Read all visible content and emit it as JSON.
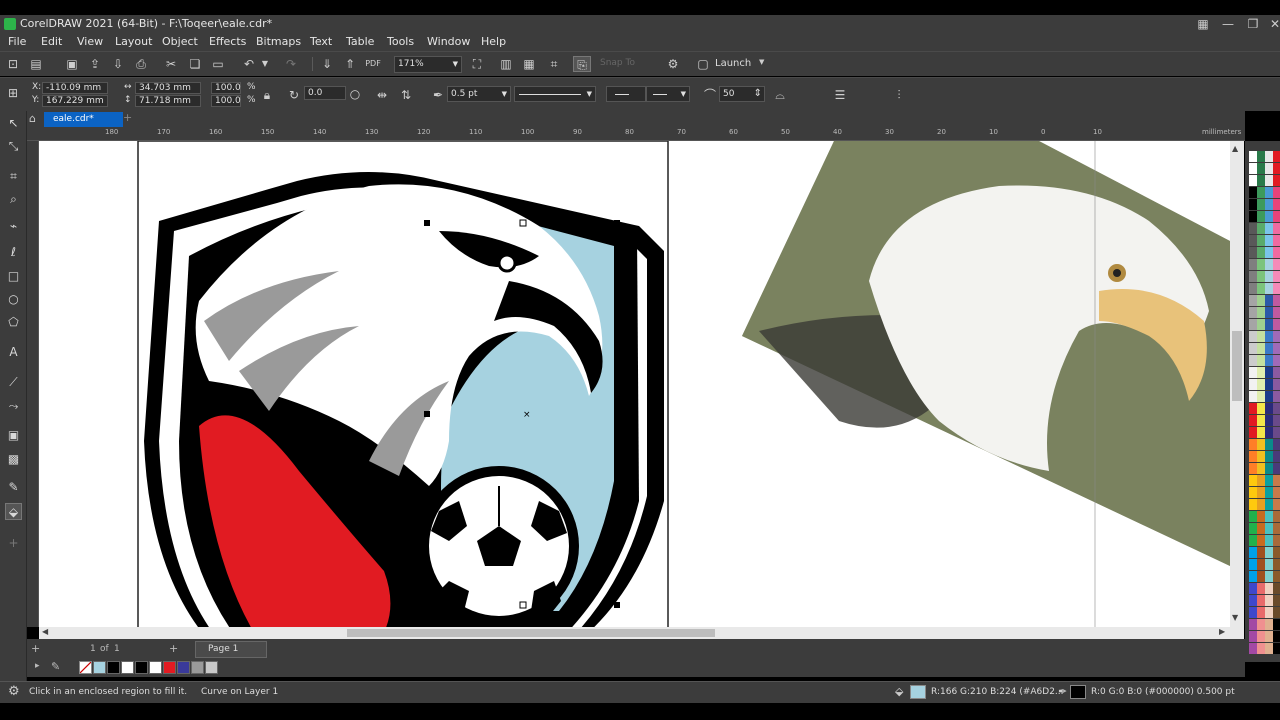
{
  "app": {
    "title": "CorelDRAW 2021 (64-Bit) - F:\\Toqeer\\eale.cdr*"
  },
  "menu": [
    "File",
    "Edit",
    "View",
    "Layout",
    "Object",
    "Effects",
    "Bitmaps",
    "Text",
    "Table",
    "Tools",
    "Window",
    "Help"
  ],
  "toolbar": {
    "zoom": "171%",
    "snap_to": "Snap To",
    "launch": "Launch"
  },
  "propbar": {
    "x_label": "X:",
    "y_label": "Y:",
    "x": "-110.09 mm",
    "y": "167.229 mm",
    "w": "34.703 mm",
    "h": "71.718 mm",
    "scale_w": "100.0",
    "scale_h": "100.0",
    "pct": "%",
    "rotation": "0.0",
    "outline_width": "0.5 pt",
    "smooth_value": "50"
  },
  "document_tab": "eale.cdr*",
  "ruler": {
    "units": "millimeters",
    "ticks": [
      "180",
      "170",
      "160",
      "150",
      "140",
      "130",
      "120",
      "110",
      "100",
      "90",
      "80",
      "70",
      "60",
      "50",
      "40",
      "30",
      "20",
      "10",
      "0",
      "10"
    ]
  },
  "pagebar": {
    "current": "1",
    "of_label": "of",
    "total": "1",
    "page_tab": "Page 1"
  },
  "status": {
    "hint": "Click in an enclosed region to fill it.",
    "object": "Curve on Layer 1",
    "fill_info": "R:166 G:210 B:224 (#A6D2...",
    "outline_info": "R:0 G:0 B:0 (#000000)  0.500 pt",
    "fill_color": "#A6D2E0",
    "outline_color": "#000000"
  },
  "doc_palette_colors": [
    "#A6D2E0",
    "#000000",
    "#ffffff",
    "#000000",
    "#ffffff",
    "#e11b22",
    "#3a3a9a",
    "#9a9a9a",
    "#c8c8c8"
  ],
  "palette_colors": [
    [
      "#ffffff",
      "#2a7a4a",
      "#e8e8e8",
      "#e11b22"
    ],
    [
      "#000000",
      "#3d9a5c",
      "#4a9ad4",
      "#e8437a"
    ],
    [
      "#595959",
      "#5aaa6a",
      "#7ac4e8",
      "#f06aa0"
    ],
    [
      "#7f7f7f",
      "#7cc47c",
      "#a6d2e0",
      "#f58ab8"
    ],
    [
      "#a5a5a5",
      "#a0d090",
      "#2a5aa8",
      "#c05aa0"
    ],
    [
      "#cccccc",
      "#c4e0a0",
      "#3a7ac8",
      "#a06ab8"
    ],
    [
      "#f2f2f2",
      "#e0eeb0",
      "#1a3a8a",
      "#8a5aa0"
    ],
    [
      "#e11b22",
      "#f4e64a",
      "#2a2a7a",
      "#6a4a8a"
    ],
    [
      "#ff7f27",
      "#f0c020",
      "#0a8a8a",
      "#4a3a7a"
    ],
    [
      "#ffc90e",
      "#e8a020",
      "#0aa0a0",
      "#c87a4a"
    ],
    [
      "#22b14c",
      "#c86a20",
      "#4ac0c0",
      "#a86a3a"
    ],
    [
      "#00a2e8",
      "#a05020",
      "#80d0d0",
      "#8a5a2a"
    ],
    [
      "#3f48cc",
      "#e86a6a",
      "#f0d0c0",
      "#6a4a2a"
    ],
    [
      "#a349a4",
      "#f09090",
      "#e0b090",
      "#000000"
    ]
  ],
  "colors": {
    "ui_bg": "#3c3c3c",
    "accent": "#0b63c4",
    "shield_red": "#e11b22",
    "shield_blue": "#a6d2e0"
  }
}
